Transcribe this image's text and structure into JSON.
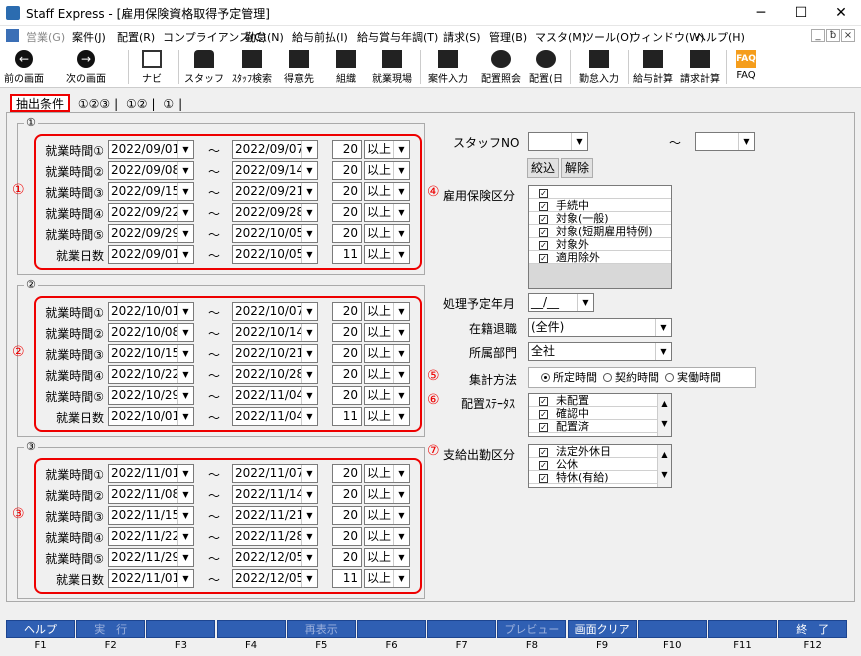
{
  "window": {
    "title": "Staff Express - [雇用保険資格取得予定管理]",
    "minimize": "─",
    "maximize": "☐",
    "close": "✕"
  },
  "menu": [
    "営業(G)",
    "案件(J)",
    "配置(R)",
    "コンプライアンス(C)",
    "勤怠(N)",
    "給与前払(I)",
    "給与賞与年調(T)",
    "請求(S)",
    "管理(B)",
    "マスタ(M)",
    "ツール(O)",
    "ウィンドウ(W)",
    "ヘルプ(H)"
  ],
  "mdi_buttons": [
    "_",
    "ƀ",
    "×"
  ],
  "toolbar": {
    "prev": "前の画面",
    "next": "次の画面",
    "navi": "ナビ",
    "staff": "スタッフ",
    "staff_search": "ｽﾀｯﾌ検索",
    "client": "得意先",
    "org": "組織",
    "site": "就業現場",
    "case_input": "案件入力",
    "assign_view": "配置照会",
    "assign_day": "配置(日",
    "attendance": "勤怠入力",
    "salary_calc": "給与計算",
    "billing_calc": "請求計算",
    "faq": "FAQ",
    "faq_icon": "FAQ"
  },
  "tabs": [
    "抽出条件",
    "①②③",
    "①②",
    "①"
  ],
  "groups": [
    {
      "label": "①",
      "marker": "①",
      "rows": [
        {
          "label": "就業時間①",
          "from": "2022/09/01",
          "to": "2022/09/07",
          "num": "20",
          "cond": "以上"
        },
        {
          "label": "就業時間②",
          "from": "2022/09/08",
          "to": "2022/09/14",
          "num": "20",
          "cond": "以上"
        },
        {
          "label": "就業時間③",
          "from": "2022/09/15",
          "to": "2022/09/21",
          "num": "20",
          "cond": "以上"
        },
        {
          "label": "就業時間④",
          "from": "2022/09/22",
          "to": "2022/09/28",
          "num": "20",
          "cond": "以上"
        },
        {
          "label": "就業時間⑤",
          "from": "2022/09/29",
          "to": "2022/10/05",
          "num": "20",
          "cond": "以上"
        },
        {
          "label": "就業日数",
          "from": "2022/09/01",
          "to": "2022/10/05",
          "num": "11",
          "cond": "以上"
        }
      ]
    },
    {
      "label": "②",
      "marker": "②",
      "rows": [
        {
          "label": "就業時間①",
          "from": "2022/10/01",
          "to": "2022/10/07",
          "num": "20",
          "cond": "以上"
        },
        {
          "label": "就業時間②",
          "from": "2022/10/08",
          "to": "2022/10/14",
          "num": "20",
          "cond": "以上"
        },
        {
          "label": "就業時間③",
          "from": "2022/10/15",
          "to": "2022/10/21",
          "num": "20",
          "cond": "以上"
        },
        {
          "label": "就業時間④",
          "from": "2022/10/22",
          "to": "2022/10/28",
          "num": "20",
          "cond": "以上"
        },
        {
          "label": "就業時間⑤",
          "from": "2022/10/29",
          "to": "2022/11/04",
          "num": "20",
          "cond": "以上"
        },
        {
          "label": "就業日数",
          "from": "2022/10/01",
          "to": "2022/11/04",
          "num": "11",
          "cond": "以上"
        }
      ]
    },
    {
      "label": "③",
      "marker": "③",
      "rows": [
        {
          "label": "就業時間①",
          "from": "2022/11/01",
          "to": "2022/11/07",
          "num": "20",
          "cond": "以上"
        },
        {
          "label": "就業時間②",
          "from": "2022/11/08",
          "to": "2022/11/14",
          "num": "20",
          "cond": "以上"
        },
        {
          "label": "就業時間③",
          "from": "2022/11/15",
          "to": "2022/11/21",
          "num": "20",
          "cond": "以上"
        },
        {
          "label": "就業時間④",
          "from": "2022/11/22",
          "to": "2022/11/28",
          "num": "20",
          "cond": "以上"
        },
        {
          "label": "就業時間⑤",
          "from": "2022/11/29",
          "to": "2022/12/05",
          "num": "20",
          "cond": "以上"
        },
        {
          "label": "就業日数",
          "from": "2022/11/01",
          "to": "2022/12/05",
          "num": "11",
          "cond": "以上"
        }
      ]
    }
  ],
  "tilde": "～",
  "dropdown_arrow": "▼",
  "checkmark": "✓",
  "scroll_up": "▲",
  "scroll_down": "▼",
  "right": {
    "staff_no_label": "スタッフNO",
    "staff_tilde": "～",
    "filter_button": "絞込",
    "clear_button": "解除",
    "emp_ins_marker": "④",
    "emp_ins_label": "雇用保険区分",
    "emp_ins_items": [
      {
        "label": "",
        "checked": true
      },
      {
        "label": "手続中",
        "checked": true
      },
      {
        "label": "対象(一般)",
        "checked": true
      },
      {
        "label": "対象(短期雇用特例)",
        "checked": true
      },
      {
        "label": "対象外",
        "checked": true
      },
      {
        "label": "適用除外",
        "checked": true
      }
    ],
    "plan_month_label": "処理予定年月",
    "plan_month_value": "__/__",
    "enrollment_label": "在籍退職",
    "enrollment_value": "(全件)",
    "dept_label": "所属部門",
    "dept_value": "全社",
    "agg_marker": "⑤",
    "agg_label": "集計方法",
    "agg_options": [
      {
        "label": "所定時間",
        "selected": true
      },
      {
        "label": "契約時間",
        "selected": false
      },
      {
        "label": "実働時間",
        "selected": false
      }
    ],
    "assign_marker": "⑥",
    "assign_label": "配置ｽﾃｰﾀｽ",
    "assign_items": [
      {
        "label": "未配置",
        "checked": true
      },
      {
        "label": "確認中",
        "checked": true
      },
      {
        "label": "配置済",
        "checked": true
      }
    ],
    "pay_marker": "⑦",
    "pay_label": "支給出勤区分",
    "pay_items": [
      {
        "label": "法定外休日",
        "checked": true
      },
      {
        "label": "公休",
        "checked": true
      },
      {
        "label": "特休(有給)",
        "checked": true
      }
    ]
  },
  "fkeys": [
    {
      "label": "ヘルプ",
      "key": "F1",
      "dim": false
    },
    {
      "label": "実　行",
      "key": "F2",
      "dim": true
    },
    {
      "label": "",
      "key": "F3",
      "dim": false
    },
    {
      "label": "",
      "key": "F4",
      "dim": false
    },
    {
      "label": "再表示",
      "key": "F5",
      "dim": true
    },
    {
      "label": "",
      "key": "F6",
      "dim": false
    },
    {
      "label": "",
      "key": "F7",
      "dim": false
    },
    {
      "label": "プレビュー",
      "key": "F8",
      "dim": true
    },
    {
      "label": "画面クリア",
      "key": "F9",
      "dim": false
    },
    {
      "label": "",
      "key": "F10",
      "dim": false
    },
    {
      "label": "",
      "key": "F11",
      "dim": false
    },
    {
      "label": "終　了",
      "key": "F12",
      "dim": false
    }
  ],
  "colors": {
    "accent_red": "#e00000",
    "fkey_blue": "#2f5fb3"
  }
}
